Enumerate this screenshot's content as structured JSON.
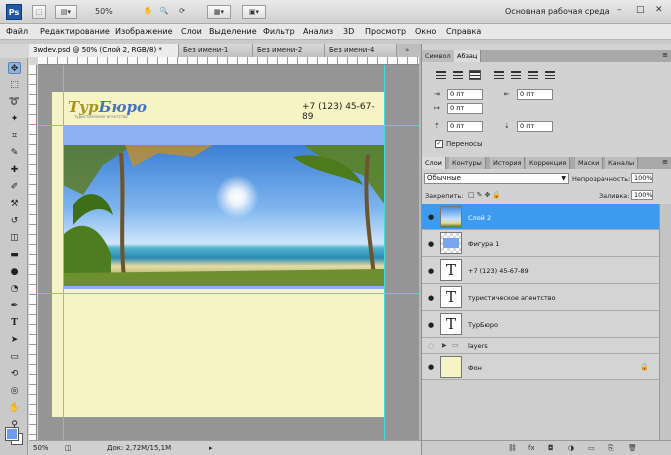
{
  "topbar": {
    "logo": "Ps",
    "zoom": "50%",
    "workspace": "Основная рабочая среда",
    "window_controls": [
      "–",
      "□",
      "✕"
    ]
  },
  "menu": [
    "Файл",
    "Редактирование",
    "Изображение",
    "Слои",
    "Выделение",
    "Фильтр",
    "Анализ",
    "3D",
    "Просмотр",
    "Окно",
    "Справка"
  ],
  "document_tabs": [
    {
      "label": "3wdev.psd @ 50% (Слой 2, RGB/8) *",
      "active": true
    },
    {
      "label": "Без имени-1",
      "active": false
    },
    {
      "label": "Без имени-2",
      "active": false
    },
    {
      "label": "Без имени-4",
      "active": false
    }
  ],
  "canvas": {
    "logo_part1": "Тур",
    "logo_part2": "Бюро",
    "tagline": "туристическое агентство",
    "phone": "+7 (123) 45-67-89"
  },
  "status": {
    "zoom": "50%",
    "doc_info": "Док: 2,72M/15,1M"
  },
  "char_panel": {
    "tabs": [
      "Символ",
      "Абзац"
    ],
    "indent_left": "0 пт",
    "indent_right": "0 пт",
    "indent_first": "0 пт",
    "space_before": "0 пт",
    "space_after": "0 пт",
    "hyphenation_label": "Переносы",
    "hyphenation_checked": "✓"
  },
  "layers_panel": {
    "tabs": [
      "Слои",
      "Контуры",
      "История",
      "Коррекция",
      "Маски",
      "Каналы"
    ],
    "blend_mode": "Обычные",
    "opacity_label": "Непрозрачность:",
    "opacity_value": "100%",
    "lock_label": "Закрепить:",
    "fill_label": "Заливка:",
    "fill_value": "100%",
    "layers": [
      {
        "name": "Слой 2",
        "kind": "image",
        "selected": true
      },
      {
        "name": "Фигура 1",
        "kind": "shape",
        "selected": false
      },
      {
        "name": "+7 (123) 45-67-89",
        "kind": "text",
        "selected": false
      },
      {
        "name": "туристическое агентство",
        "kind": "text",
        "selected": false
      },
      {
        "name": "ТурБюро",
        "kind": "text",
        "selected": false
      },
      {
        "name": "layers",
        "kind": "group",
        "selected": false
      },
      {
        "name": "Фон",
        "kind": "background",
        "selected": false
      }
    ],
    "text_thumb_glyph": "T"
  },
  "icons": {
    "eye": "eye-icon",
    "lock": "lock-icon",
    "folder": "folder-icon"
  },
  "colors": {
    "accent": "#3d9bef",
    "page_bg": "#f6f4c4",
    "band": "#8cb0f2",
    "guide": "#49d9d9",
    "foreground_swatch": "#6d9bf0"
  }
}
